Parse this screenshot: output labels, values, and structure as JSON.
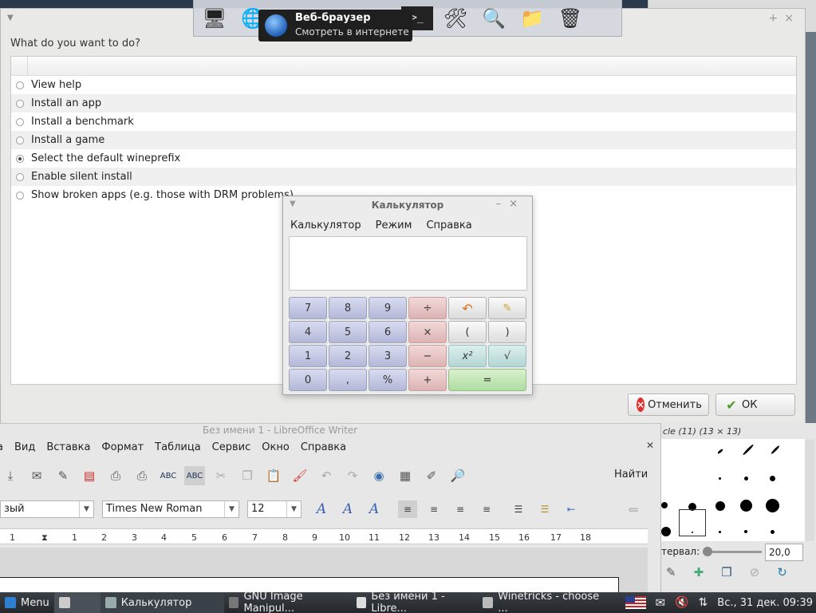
{
  "dock": {
    "tooltip_title": "Веб-браузер",
    "tooltip_subtitle": "Смотреть в интернете",
    "icons": [
      "desktop-icon",
      "web-browser-icon",
      "terminal-icon",
      "settings-icon",
      "search-icon",
      "folder-icon",
      "trash-icon"
    ]
  },
  "winetricks": {
    "question": "What do you want to do?",
    "options": [
      {
        "label": "View help",
        "checked": false
      },
      {
        "label": "Install an app",
        "checked": false
      },
      {
        "label": "Install a benchmark",
        "checked": false
      },
      {
        "label": "Install a game",
        "checked": false
      },
      {
        "label": "Select the default wineprefix",
        "checked": true
      },
      {
        "label": "Enable silent install",
        "checked": false
      },
      {
        "label": "Show broken apps (e.g. those with DRM problems)",
        "checked": false
      }
    ],
    "cancel_label": "Отменить",
    "ok_label": "ОК"
  },
  "calculator": {
    "title": "Калькулятор",
    "menu": [
      "Калькулятор",
      "Режим",
      "Справка"
    ],
    "display_value": "",
    "keys": [
      {
        "label": "7",
        "kind": "num"
      },
      {
        "label": "8",
        "kind": "num"
      },
      {
        "label": "9",
        "kind": "num"
      },
      {
        "label": "÷",
        "kind": "op"
      },
      {
        "label": "↶",
        "kind": "gray"
      },
      {
        "label": "🧹",
        "kind": "gray"
      },
      {
        "label": "4",
        "kind": "num"
      },
      {
        "label": "5",
        "kind": "num"
      },
      {
        "label": "6",
        "kind": "num"
      },
      {
        "label": "×",
        "kind": "op"
      },
      {
        "label": "(",
        "kind": "gray"
      },
      {
        "label": ")",
        "kind": "gray"
      },
      {
        "label": "1",
        "kind": "num"
      },
      {
        "label": "2",
        "kind": "num"
      },
      {
        "label": "3",
        "kind": "num"
      },
      {
        "label": "−",
        "kind": "op"
      },
      {
        "label": "x²",
        "kind": "teal"
      },
      {
        "label": "√",
        "kind": "teal"
      },
      {
        "label": "0",
        "kind": "num"
      },
      {
        "label": ",",
        "kind": "num"
      },
      {
        "label": "%",
        "kind": "num"
      },
      {
        "label": "+",
        "kind": "op"
      },
      {
        "label": "=",
        "kind": "green"
      }
    ]
  },
  "writer": {
    "title": "Без имени 1 - LibreOffice Writer",
    "menu": [
      "а",
      "Вид",
      "Вставка",
      "Формат",
      "Таблица",
      "Сервис",
      "Окно",
      "Справка"
    ],
    "find_label": "Найти",
    "style_value": "зый",
    "font_value": "Times New Roman",
    "size_value": "12",
    "ruler_marks": [
      "1",
      "1",
      "2",
      "3",
      "4",
      "5",
      "6",
      "7",
      "8",
      "9",
      "10",
      "11",
      "12",
      "13",
      "14",
      "15",
      "16",
      "17",
      "18"
    ]
  },
  "gimp": {
    "brush_caption": "cle (11) (13 × 13)",
    "interval_label": "тервал:",
    "interval_value": "20,0"
  },
  "taskbar": {
    "menu_label": "Menu",
    "tasks": [
      "Калькулятор",
      "GNU Image Manipul...",
      "Без имени 1 - Libre...",
      "Winetricks - choose ..."
    ],
    "clock": "Вс., 31 дек.  09:39"
  }
}
